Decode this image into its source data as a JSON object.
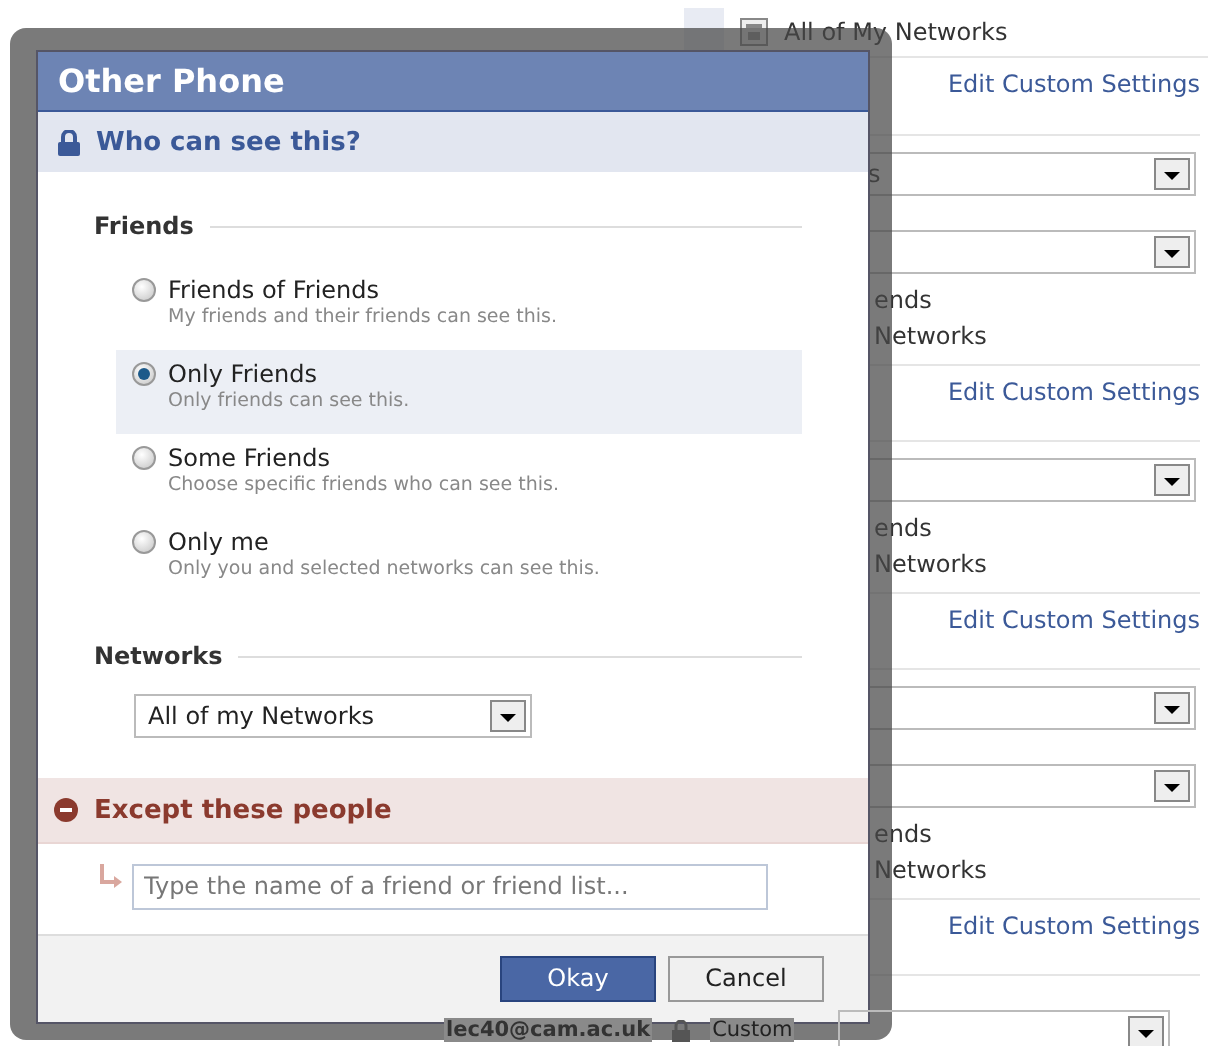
{
  "background": {
    "header": {
      "label": "All of My Networks"
    },
    "rows": [
      {
        "kind": "link",
        "label": "Edit Custom Settings"
      },
      {
        "kind": "select",
        "value": "s"
      },
      {
        "kind": "select"
      },
      {
        "kind": "text",
        "label": "ends"
      },
      {
        "kind": "text",
        "label": "Networks"
      },
      {
        "kind": "link",
        "label": "Edit Custom Settings"
      },
      {
        "kind": "select"
      },
      {
        "kind": "text",
        "label": "ends"
      },
      {
        "kind": "text",
        "label": "Networks"
      },
      {
        "kind": "link",
        "label": "Edit Custom Settings"
      },
      {
        "kind": "select"
      },
      {
        "kind": "select"
      },
      {
        "kind": "text",
        "label": "ends"
      },
      {
        "kind": "text",
        "label": "Networks"
      },
      {
        "kind": "link",
        "label": "Edit Custom Settings"
      }
    ],
    "footer": {
      "email": "lec40@cam.ac.uk",
      "audience": "Custom"
    }
  },
  "dialog": {
    "title": "Other Phone",
    "heading": "Who can see this?",
    "friends_label": "Friends",
    "options": [
      {
        "label": "Friends of Friends",
        "hint": "My friends and their friends can see this.",
        "selected": false
      },
      {
        "label": "Only Friends",
        "hint": "Only friends can see this.",
        "selected": true
      },
      {
        "label": "Some Friends",
        "hint": "Choose specific friends who can see this.",
        "selected": false
      },
      {
        "label": "Only me",
        "hint": "Only you and selected networks can see this.",
        "selected": false
      }
    ],
    "networks_label": "Networks",
    "networks_value": "All of my Networks",
    "except_heading": "Except these people",
    "except_field": {
      "placeholder": "Type the name of a friend or friend list..."
    },
    "buttons": [
      {
        "kind": "primary",
        "label": "Okay"
      },
      {
        "kind": "secondary",
        "label": "Cancel"
      }
    ]
  }
}
